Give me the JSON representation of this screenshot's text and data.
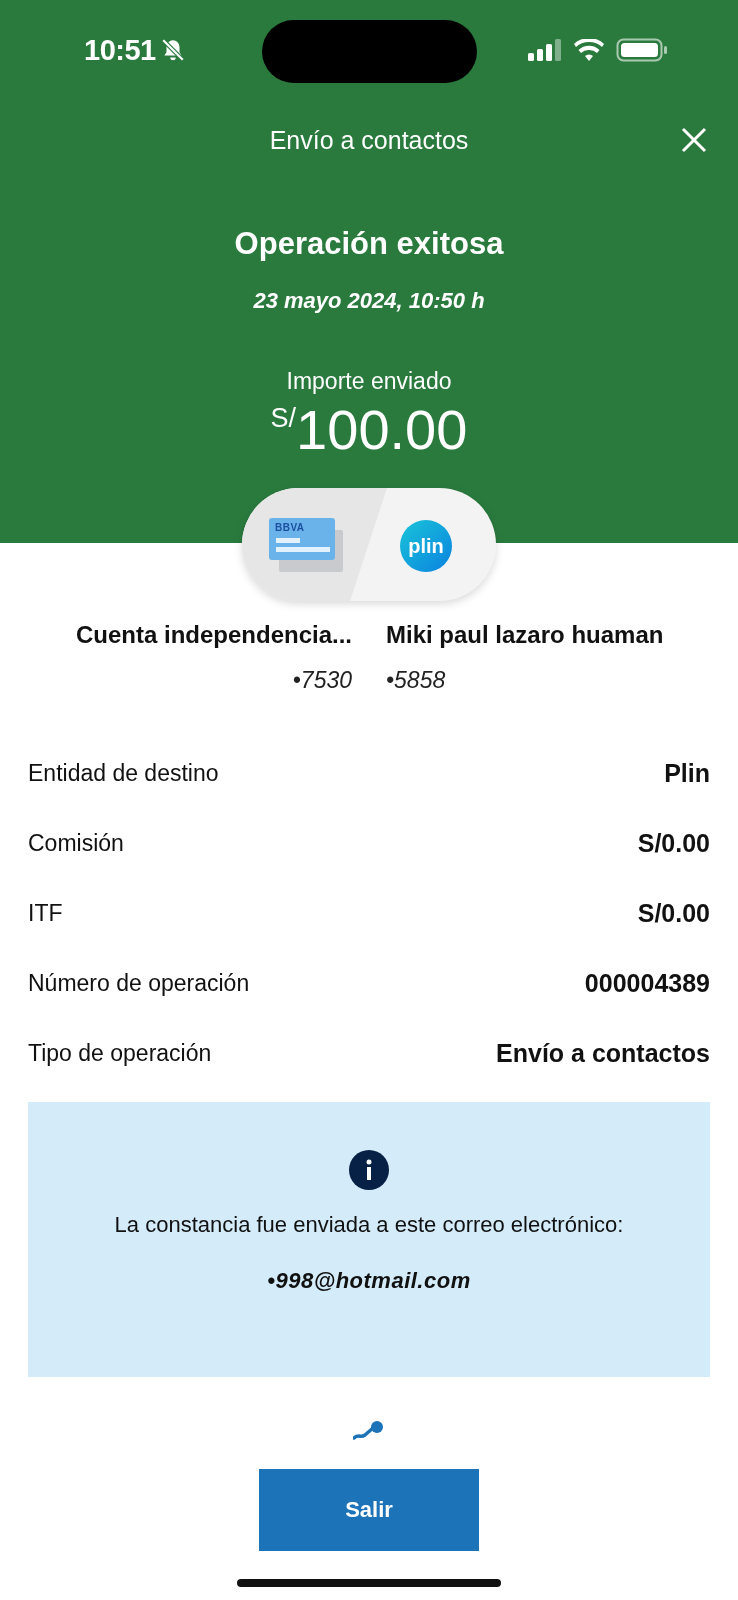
{
  "status_bar": {
    "time": "10:51"
  },
  "header": {
    "title": "Envío a contactos",
    "heading": "Operación exitosa",
    "date": "23 mayo 2024, 10:50 h",
    "amount_label": "Importe enviado",
    "currency": "S/",
    "amount": "100.00"
  },
  "transfer": {
    "origin_logo": "BBVA",
    "destination_logo": "plin",
    "origin": {
      "name": "Cuenta independencia...",
      "account": "•7530"
    },
    "destination": {
      "name": "Miki paul lazaro huaman",
      "account": "•5858"
    }
  },
  "details": [
    {
      "label": "Entidad de destino",
      "value": "Plin"
    },
    {
      "label": "Comisión",
      "value": "S/0.00"
    },
    {
      "label": "ITF",
      "value": "S/0.00"
    },
    {
      "label": "Número de operación",
      "value": "000004389"
    },
    {
      "label": "Tipo de operación",
      "value": "Envío a contactos"
    }
  ],
  "notice": {
    "text": "La constancia fue enviada a este correo electrónico:",
    "email": "•998@hotmail.com"
  },
  "buttons": [
    "Salir"
  ]
}
